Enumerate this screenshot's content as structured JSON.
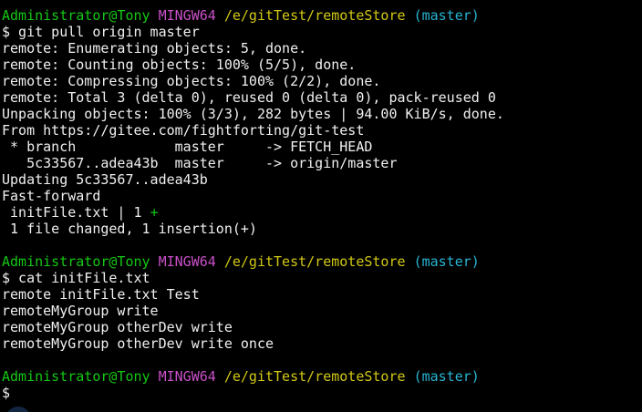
{
  "colors": {
    "background": "#000000",
    "default_text": "#f0f0f0",
    "user_host": "#14c814",
    "system": "#c850c8",
    "path": "#d2c814",
    "branch": "#28b4d2",
    "diff_plus": "#14c814"
  },
  "lines": [
    {
      "segments": [
        {
          "text": "Administrator@Tony",
          "color": "#14c814"
        },
        {
          "text": " ",
          "color": "#f0f0f0"
        },
        {
          "text": "MINGW64",
          "color": "#c850c8"
        },
        {
          "text": " ",
          "color": "#f0f0f0"
        },
        {
          "text": "/e/gitTest/remoteStore",
          "color": "#d2c814"
        },
        {
          "text": " ",
          "color": "#f0f0f0"
        },
        {
          "text": "(master)",
          "color": "#28b4d2"
        }
      ]
    },
    {
      "segments": [
        {
          "text": "$ git pull origin master",
          "color": "#f0f0f0"
        }
      ]
    },
    {
      "segments": [
        {
          "text": "remote: Enumerating objects: 5, done.",
          "color": "#f0f0f0"
        }
      ]
    },
    {
      "segments": [
        {
          "text": "remote: Counting objects: 100% (5/5), done.",
          "color": "#f0f0f0"
        }
      ]
    },
    {
      "segments": [
        {
          "text": "remote: Compressing objects: 100% (2/2), done.",
          "color": "#f0f0f0"
        }
      ]
    },
    {
      "segments": [
        {
          "text": "remote: Total 3 (delta 0), reused 0 (delta 0), pack-reused 0",
          "color": "#f0f0f0"
        }
      ]
    },
    {
      "segments": [
        {
          "text": "Unpacking objects: 100% (3/3), 282 bytes | 94.00 KiB/s, done.",
          "color": "#f0f0f0"
        }
      ]
    },
    {
      "segments": [
        {
          "text": "From https://gitee.com/fightforting/git-test",
          "color": "#f0f0f0"
        }
      ]
    },
    {
      "segments": [
        {
          "text": " * branch            master     -> FETCH_HEAD",
          "color": "#f0f0f0"
        }
      ]
    },
    {
      "segments": [
        {
          "text": "   5c33567..adea43b  master     -> origin/master",
          "color": "#f0f0f0"
        }
      ]
    },
    {
      "segments": [
        {
          "text": "Updating 5c33567..adea43b",
          "color": "#f0f0f0"
        }
      ]
    },
    {
      "segments": [
        {
          "text": "Fast-forward",
          "color": "#f0f0f0"
        }
      ]
    },
    {
      "segments": [
        {
          "text": " initFile.txt | 1 ",
          "color": "#f0f0f0"
        },
        {
          "text": "+",
          "color": "#14c814"
        }
      ]
    },
    {
      "segments": [
        {
          "text": " 1 file changed, 1 insertion(+)",
          "color": "#f0f0f0"
        }
      ]
    },
    {
      "segments": [
        {
          "text": "",
          "color": "#f0f0f0"
        }
      ]
    },
    {
      "segments": [
        {
          "text": "Administrator@Tony",
          "color": "#14c814"
        },
        {
          "text": " ",
          "color": "#f0f0f0"
        },
        {
          "text": "MINGW64",
          "color": "#c850c8"
        },
        {
          "text": " ",
          "color": "#f0f0f0"
        },
        {
          "text": "/e/gitTest/remoteStore",
          "color": "#d2c814"
        },
        {
          "text": " ",
          "color": "#f0f0f0"
        },
        {
          "text": "(master)",
          "color": "#28b4d2"
        }
      ]
    },
    {
      "segments": [
        {
          "text": "$ cat initFile.txt",
          "color": "#f0f0f0"
        }
      ]
    },
    {
      "segments": [
        {
          "text": "remote initFile.txt Test",
          "color": "#f0f0f0"
        }
      ]
    },
    {
      "segments": [
        {
          "text": "remoteMyGroup write",
          "color": "#f0f0f0"
        }
      ]
    },
    {
      "segments": [
        {
          "text": "remoteMyGroup otherDev write",
          "color": "#f0f0f0"
        }
      ]
    },
    {
      "segments": [
        {
          "text": "remoteMyGroup otherDev write once",
          "color": "#f0f0f0"
        }
      ]
    },
    {
      "segments": [
        {
          "text": "",
          "color": "#f0f0f0"
        }
      ]
    },
    {
      "segments": [
        {
          "text": "Administrator@Tony",
          "color": "#14c814"
        },
        {
          "text": " ",
          "color": "#f0f0f0"
        },
        {
          "text": "MINGW64",
          "color": "#c850c8"
        },
        {
          "text": " ",
          "color": "#f0f0f0"
        },
        {
          "text": "/e/gitTest/remoteStore",
          "color": "#d2c814"
        },
        {
          "text": " ",
          "color": "#f0f0f0"
        },
        {
          "text": "(master)",
          "color": "#28b4d2"
        }
      ]
    },
    {
      "segments": [
        {
          "text": "$",
          "color": "#f0f0f0"
        }
      ]
    }
  ]
}
